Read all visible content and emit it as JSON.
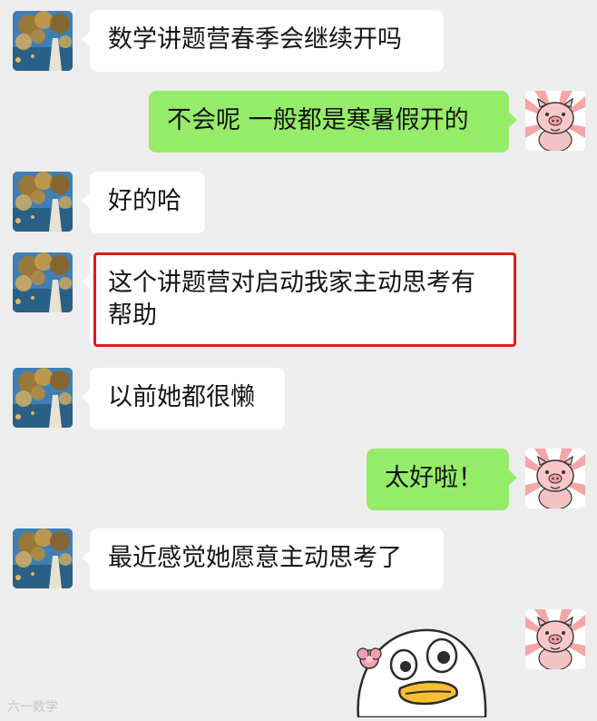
{
  "messages": [
    {
      "side": "left",
      "text": "数学讲题营春季会继续开吗"
    },
    {
      "side": "right",
      "text": "不会呢 一般都是寒暑假开的"
    },
    {
      "side": "left",
      "text": "好的哈"
    },
    {
      "side": "left",
      "text": "这个讲题营对启动我家主动思考有帮助",
      "highlighted": true
    },
    {
      "side": "left",
      "text": "以前她都很懒"
    },
    {
      "side": "right",
      "text": "太好啦！"
    },
    {
      "side": "left",
      "text": "最近感觉她愿意主动思考了"
    },
    {
      "side": "right",
      "type": "sticker",
      "sticker": "duck-sticker"
    }
  ],
  "watermark": "六一数学",
  "colors": {
    "background": "#ededed",
    "incoming_bubble": "#ffffff",
    "outgoing_bubble": "#95ec69",
    "highlight_border": "#e0191b"
  },
  "icons": {
    "contact_avatar": "tree-photo-avatar",
    "self_avatar": "pig-cartoon-avatar",
    "sticker": "duck-sticker"
  }
}
